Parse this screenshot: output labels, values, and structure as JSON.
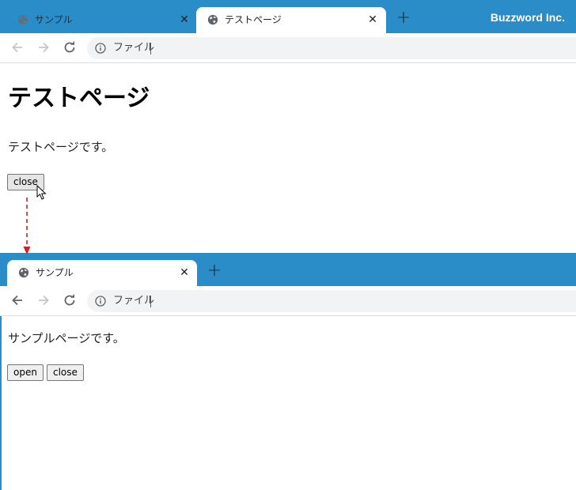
{
  "brand": "Buzzword Inc.",
  "top_window": {
    "tabs": [
      {
        "title": "サンプル",
        "close": "✕",
        "active": false
      },
      {
        "title": "テストページ",
        "close": "✕",
        "active": true
      }
    ],
    "new_tab": "+",
    "address": {
      "scheme_label": "ファイル"
    },
    "page": {
      "heading": "テストページ",
      "paragraph": "テストページです。",
      "close_button": "close"
    }
  },
  "bottom_window": {
    "tabs": [
      {
        "title": "サンプル",
        "close": "✕",
        "active": true
      }
    ],
    "new_tab": "+",
    "address": {
      "scheme_label": "ファイル"
    },
    "page": {
      "paragraph": "サンプルページです。",
      "open_button": "open",
      "close_button": "close"
    }
  },
  "colors": {
    "tabstrip": "#2b8dc8",
    "arrow": "#d91c1c"
  },
  "icons": [
    "globe-icon",
    "close-icon",
    "plus-icon",
    "back-arrow-icon",
    "forward-arrow-icon",
    "reload-icon",
    "info-icon",
    "mouse-cursor-icon",
    "dashed-arrow-icon"
  ]
}
